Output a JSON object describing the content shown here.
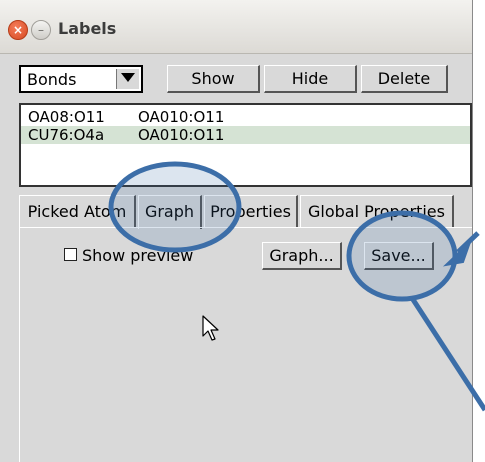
{
  "window": {
    "title": "Labels",
    "close_glyph": "×",
    "minimize_glyph": "–"
  },
  "toolbar": {
    "type_select": "Bonds",
    "show_label": "Show",
    "hide_label": "Hide",
    "delete_label": "Delete"
  },
  "labels_list": {
    "rows": [
      {
        "a": "OA08:O11",
        "b": "OA010:O11",
        "selected": false
      },
      {
        "a": "CU76:O4a",
        "b": "OA010:O11",
        "selected": true
      }
    ]
  },
  "tabs": [
    {
      "label": "Picked Atom",
      "active": false
    },
    {
      "label": "Graph",
      "active": true
    },
    {
      "label": "Properties",
      "active": false
    },
    {
      "label": "Global Properties",
      "active": false
    }
  ],
  "graph_tab": {
    "show_preview_label": "Show preview",
    "show_preview_checked": false,
    "graph_button": "Graph...",
    "save_button": "Save..."
  },
  "annotation": {
    "color": "#3c6ea8"
  }
}
